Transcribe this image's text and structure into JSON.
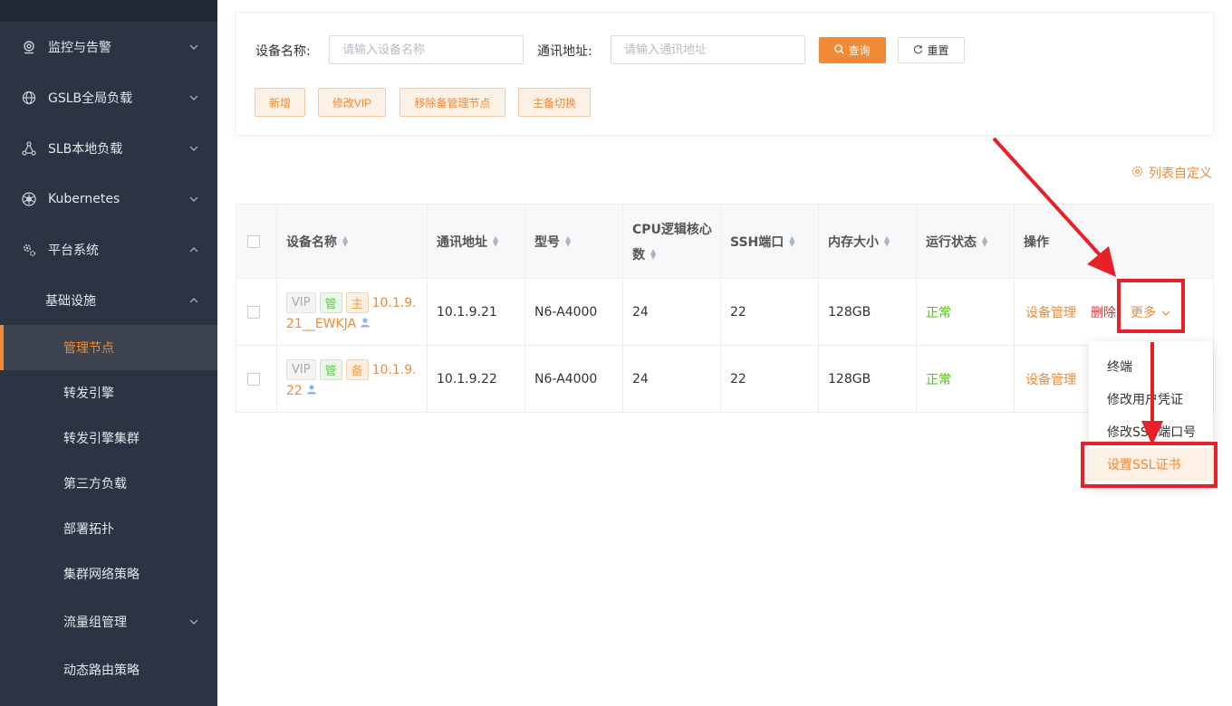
{
  "sidebar": {
    "items": [
      {
        "label": "监控与告警",
        "icon": "monitor-pin-icon",
        "chev": "⌄"
      },
      {
        "label": "GSLB全局负载",
        "icon": "globe-icon",
        "chev": "⌄"
      },
      {
        "label": "SLB本地负载",
        "icon": "network-icon",
        "chev": "⌄"
      },
      {
        "label": "Kubernetes",
        "icon": "kubernetes-icon",
        "chev": "⌄"
      },
      {
        "label": "平台系统",
        "icon": "gear-icon",
        "chev": "⌃"
      }
    ],
    "group": {
      "label": "基础设施",
      "chev": "⌃"
    },
    "subitems": [
      {
        "label": "管理节点"
      },
      {
        "label": "转发引擎"
      },
      {
        "label": "转发引擎集群"
      },
      {
        "label": "第三方负载"
      },
      {
        "label": "部署拓扑"
      },
      {
        "label": "集群网络策略"
      },
      {
        "label": "流量组管理",
        "chev": "⌄"
      },
      {
        "label": "动态路由策略"
      }
    ]
  },
  "search": {
    "name_label": "设备名称:",
    "name_placeholder": "请输入设备名称",
    "addr_label": "通讯地址:",
    "addr_placeholder": "请输入通讯地址",
    "query_label": "查询",
    "reset_label": "重置"
  },
  "actions": {
    "add": "新增",
    "edit_vip": "修改VIP",
    "remove_backup": "移除备管理节点",
    "switch": "主备切换"
  },
  "customize_label": "列表自定义",
  "table": {
    "headers": {
      "name": "设备名称",
      "addr": "通讯地址",
      "model": "型号",
      "cpu_line1": "CPU逻辑核心",
      "cpu_line2": "数",
      "ssh": "SSH端口",
      "mem": "内存大小",
      "status": "运行状态",
      "ops": "操作"
    },
    "rows": [
      {
        "tag_vip": "VIP",
        "tag_mgr": "管",
        "tag_role": "主",
        "name_line1": "10.1.9.",
        "name_line2": "21__EWKJA",
        "addr": "10.1.9.21",
        "model": "N6-A4000",
        "cpu": "24",
        "ssh": "22",
        "mem": "128GB",
        "status": "正常",
        "op_manage": "设备管理",
        "op_delete": "删除",
        "op_more": "更多"
      },
      {
        "tag_vip": "VIP",
        "tag_mgr": "管",
        "tag_role": "备",
        "name_line1": "10.1.9.",
        "name_line2": "22",
        "addr": "10.1.9.22",
        "model": "N6-A4000",
        "cpu": "24",
        "ssh": "22",
        "mem": "128GB",
        "status": "正常",
        "op_manage": "设备管理"
      }
    ]
  },
  "dropdown": {
    "items": [
      "终端",
      "修改用户凭证",
      "修改SSH端口号",
      "设置SSL证书"
    ]
  },
  "colors": {
    "accent": "#f08a36",
    "sidebar_bg": "#2b3442",
    "annotation_red": "#e8202a",
    "status_ok": "#52c41a",
    "danger": "#e03030"
  }
}
